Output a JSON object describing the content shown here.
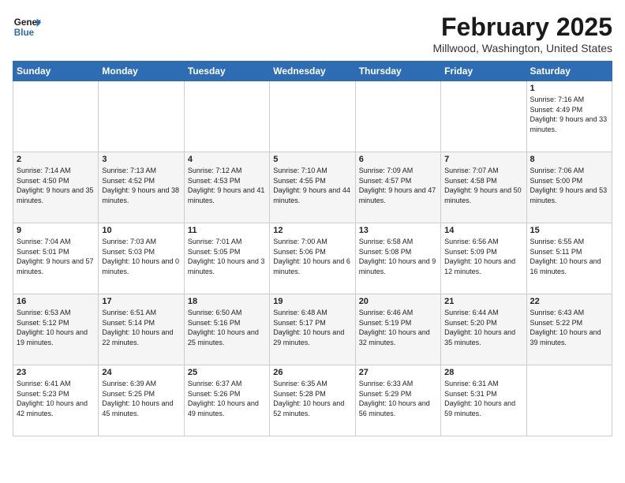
{
  "header": {
    "logo_line1": "General",
    "logo_line2": "Blue",
    "title": "February 2025",
    "subtitle": "Millwood, Washington, United States"
  },
  "weekdays": [
    "Sunday",
    "Monday",
    "Tuesday",
    "Wednesday",
    "Thursday",
    "Friday",
    "Saturday"
  ],
  "weeks": [
    [
      {
        "day": "",
        "info": ""
      },
      {
        "day": "",
        "info": ""
      },
      {
        "day": "",
        "info": ""
      },
      {
        "day": "",
        "info": ""
      },
      {
        "day": "",
        "info": ""
      },
      {
        "day": "",
        "info": ""
      },
      {
        "day": "1",
        "info": "Sunrise: 7:16 AM\nSunset: 4:49 PM\nDaylight: 9 hours and 33 minutes."
      }
    ],
    [
      {
        "day": "2",
        "info": "Sunrise: 7:14 AM\nSunset: 4:50 PM\nDaylight: 9 hours and 35 minutes."
      },
      {
        "day": "3",
        "info": "Sunrise: 7:13 AM\nSunset: 4:52 PM\nDaylight: 9 hours and 38 minutes."
      },
      {
        "day": "4",
        "info": "Sunrise: 7:12 AM\nSunset: 4:53 PM\nDaylight: 9 hours and 41 minutes."
      },
      {
        "day": "5",
        "info": "Sunrise: 7:10 AM\nSunset: 4:55 PM\nDaylight: 9 hours and 44 minutes."
      },
      {
        "day": "6",
        "info": "Sunrise: 7:09 AM\nSunset: 4:57 PM\nDaylight: 9 hours and 47 minutes."
      },
      {
        "day": "7",
        "info": "Sunrise: 7:07 AM\nSunset: 4:58 PM\nDaylight: 9 hours and 50 minutes."
      },
      {
        "day": "8",
        "info": "Sunrise: 7:06 AM\nSunset: 5:00 PM\nDaylight: 9 hours and 53 minutes."
      }
    ],
    [
      {
        "day": "9",
        "info": "Sunrise: 7:04 AM\nSunset: 5:01 PM\nDaylight: 9 hours and 57 minutes."
      },
      {
        "day": "10",
        "info": "Sunrise: 7:03 AM\nSunset: 5:03 PM\nDaylight: 10 hours and 0 minutes."
      },
      {
        "day": "11",
        "info": "Sunrise: 7:01 AM\nSunset: 5:05 PM\nDaylight: 10 hours and 3 minutes."
      },
      {
        "day": "12",
        "info": "Sunrise: 7:00 AM\nSunset: 5:06 PM\nDaylight: 10 hours and 6 minutes."
      },
      {
        "day": "13",
        "info": "Sunrise: 6:58 AM\nSunset: 5:08 PM\nDaylight: 10 hours and 9 minutes."
      },
      {
        "day": "14",
        "info": "Sunrise: 6:56 AM\nSunset: 5:09 PM\nDaylight: 10 hours and 12 minutes."
      },
      {
        "day": "15",
        "info": "Sunrise: 6:55 AM\nSunset: 5:11 PM\nDaylight: 10 hours and 16 minutes."
      }
    ],
    [
      {
        "day": "16",
        "info": "Sunrise: 6:53 AM\nSunset: 5:12 PM\nDaylight: 10 hours and 19 minutes."
      },
      {
        "day": "17",
        "info": "Sunrise: 6:51 AM\nSunset: 5:14 PM\nDaylight: 10 hours and 22 minutes."
      },
      {
        "day": "18",
        "info": "Sunrise: 6:50 AM\nSunset: 5:16 PM\nDaylight: 10 hours and 25 minutes."
      },
      {
        "day": "19",
        "info": "Sunrise: 6:48 AM\nSunset: 5:17 PM\nDaylight: 10 hours and 29 minutes."
      },
      {
        "day": "20",
        "info": "Sunrise: 6:46 AM\nSunset: 5:19 PM\nDaylight: 10 hours and 32 minutes."
      },
      {
        "day": "21",
        "info": "Sunrise: 6:44 AM\nSunset: 5:20 PM\nDaylight: 10 hours and 35 minutes."
      },
      {
        "day": "22",
        "info": "Sunrise: 6:43 AM\nSunset: 5:22 PM\nDaylight: 10 hours and 39 minutes."
      }
    ],
    [
      {
        "day": "23",
        "info": "Sunrise: 6:41 AM\nSunset: 5:23 PM\nDaylight: 10 hours and 42 minutes."
      },
      {
        "day": "24",
        "info": "Sunrise: 6:39 AM\nSunset: 5:25 PM\nDaylight: 10 hours and 45 minutes."
      },
      {
        "day": "25",
        "info": "Sunrise: 6:37 AM\nSunset: 5:26 PM\nDaylight: 10 hours and 49 minutes."
      },
      {
        "day": "26",
        "info": "Sunrise: 6:35 AM\nSunset: 5:28 PM\nDaylight: 10 hours and 52 minutes."
      },
      {
        "day": "27",
        "info": "Sunrise: 6:33 AM\nSunset: 5:29 PM\nDaylight: 10 hours and 56 minutes."
      },
      {
        "day": "28",
        "info": "Sunrise: 6:31 AM\nSunset: 5:31 PM\nDaylight: 10 hours and 59 minutes."
      },
      {
        "day": "",
        "info": ""
      }
    ]
  ]
}
